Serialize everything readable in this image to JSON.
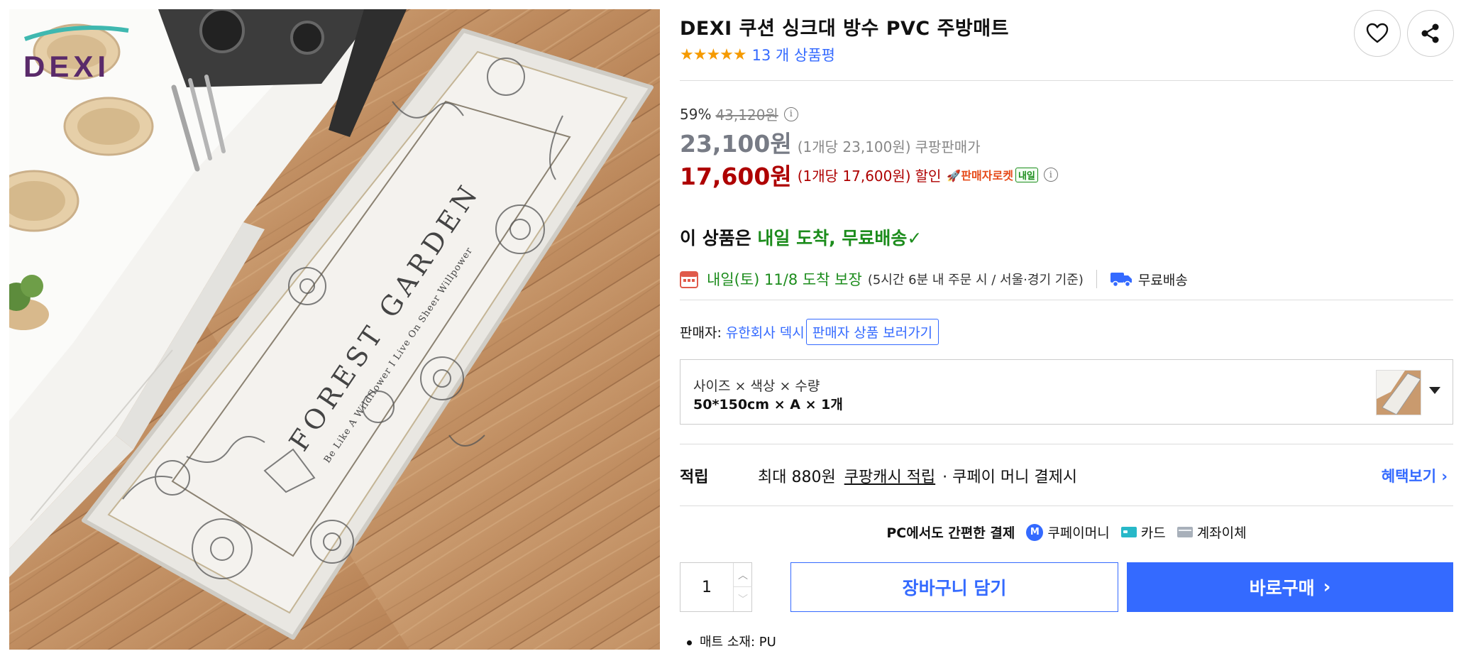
{
  "product": {
    "brand_logo": "DEXI",
    "image_texts": {
      "mat_title": "FOREST GARDEN",
      "mat_subtitle": "Be Like A Wildflower I Live On Sheer Willpower"
    },
    "title": "DEXI 쿠션 싱크대 방수 PVC 주방매트",
    "rating": {
      "stars": 5,
      "star_glyphs": "★★★★★",
      "review_text": "13 개 상품평"
    }
  },
  "actions": {
    "heart_icon": "heart-icon",
    "share_icon": "share-icon"
  },
  "price": {
    "discount_rate": "59%",
    "original_price": "43,120원",
    "sale_price": "23,100원",
    "sale_unit": "(1개당 23,100원)",
    "sale_label": "쿠팡판매가",
    "coupon_price": "17,600원",
    "coupon_unit": "(1개당 17,600원)",
    "coupon_label": "할인",
    "rocket_label": "🚀판매자로켓",
    "rocket_tomorrow": "내일",
    "info_glyph": "i",
    "colors": {
      "coupon": "#ae0000",
      "sale": "#777b85",
      "accent": "#346aff",
      "green": "#1c8c1c"
    }
  },
  "shipping": {
    "headline_prefix": "이 상품은 ",
    "headline_green": "내일 도착, 무료배송",
    "check_glyph": "✓",
    "arrival_main": "내일(토) 11/8 도착 보장",
    "arrival_note": "(5시간 6분 내 주문 시 / 서울·경기 기준)",
    "free_shipping": "무료배송"
  },
  "seller": {
    "label": "판매자:",
    "name": "유한회사 덱시",
    "button": "판매자 상품 보러가기"
  },
  "option": {
    "label": "사이즈 × 색상 × 수량",
    "value": "50*150cm × A × 1개"
  },
  "points": {
    "label": "적립",
    "max_text": "최대 880원",
    "cash_link": "쿠팡캐시 적립",
    "suffix": "· 쿠페이 머니 결제시",
    "benefit_link": "혜택보기 ›"
  },
  "payment": {
    "title": "PC에서도 간편한 결제",
    "methods": [
      {
        "label": "쿠페이머니",
        "icon": "M"
      },
      {
        "label": "카드",
        "icon": "card-icon"
      },
      {
        "label": "계좌이체",
        "icon": "bank-icon"
      }
    ]
  },
  "purchase": {
    "quantity": "1",
    "up_glyph": "︿",
    "down_glyph": "﹀",
    "cart_button": "장바구니 담기",
    "buy_button": "바로구매",
    "buy_chevron": "›"
  },
  "specs": [
    "매트 소재: PU"
  ]
}
